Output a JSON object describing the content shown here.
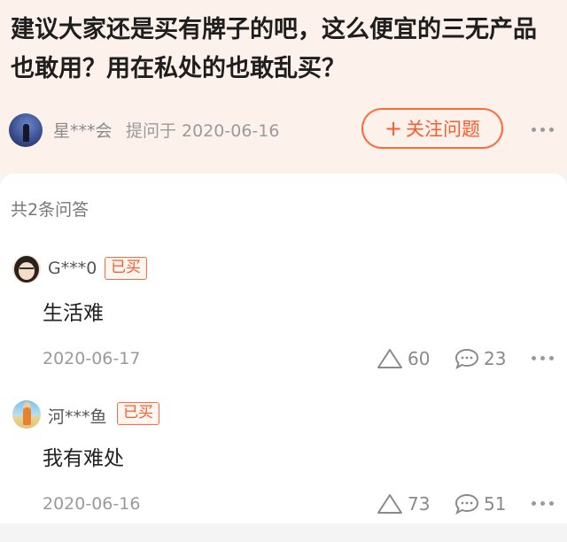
{
  "question": {
    "title": "建议大家还是买有牌子的吧，这么便宜的三无产品也敢用？用在私处的也敢乱买？",
    "asker": "星***会",
    "asked_on": "提问于 2020-06-16",
    "follow_label": "关注问题",
    "follow_plus": "+"
  },
  "answers_count": "共2条问答",
  "answers": [
    {
      "user": "G***0",
      "badge": "已买",
      "text": "生活难",
      "date": "2020-06-17",
      "likes": "60",
      "comments": "23",
      "avatar_icon": "avatar-girl-icon"
    },
    {
      "user": "河***鱼",
      "badge": "已买",
      "text": "我有难处",
      "date": "2020-06-16",
      "likes": "73",
      "comments": "51",
      "avatar_icon": "avatar-beach-icon"
    }
  ],
  "colors": {
    "accent": "#ff5a2a",
    "header_bg": "#fdf1ec",
    "muted_text": "#9a9a9a"
  }
}
